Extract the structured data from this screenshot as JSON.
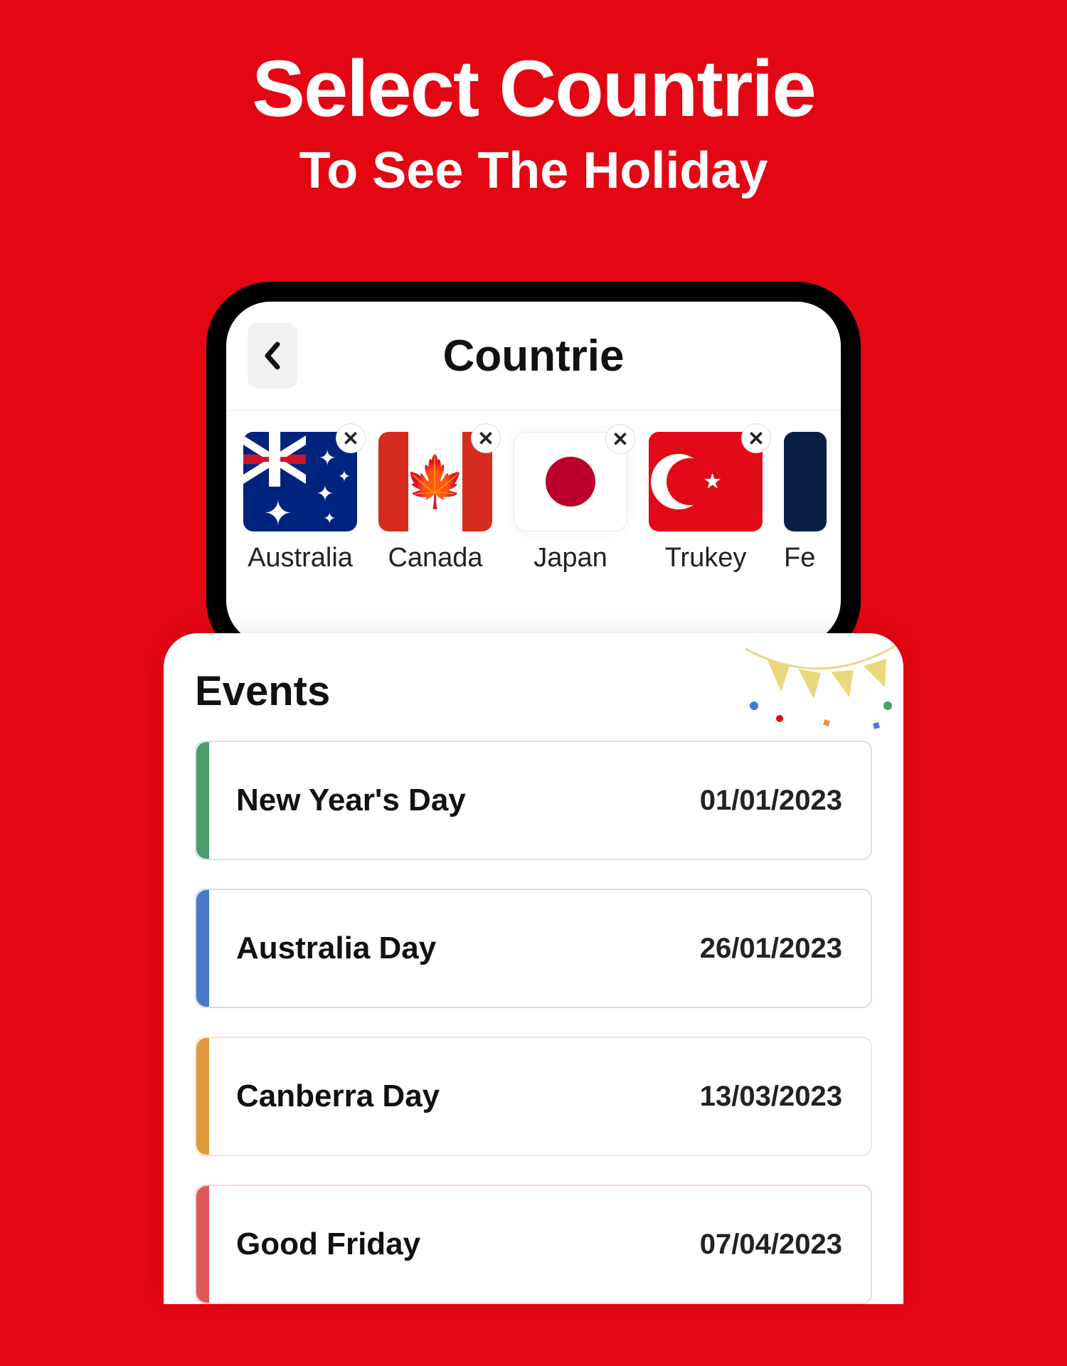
{
  "hero": {
    "title": "Select Countrie",
    "subtitle": "To See The Holiday"
  },
  "topbar": {
    "title": "Countrie"
  },
  "countries": [
    {
      "label": "Australia"
    },
    {
      "label": "Canada"
    },
    {
      "label": "Japan"
    },
    {
      "label": "Trukey"
    },
    {
      "label": "Fe"
    }
  ],
  "events": {
    "heading": "Events",
    "items": [
      {
        "name": "New Year's Day",
        "date": "01/01/2023",
        "color": "green"
      },
      {
        "name": "Australia Day",
        "date": "26/01/2023",
        "color": "blue"
      },
      {
        "name": "Canberra Day",
        "date": "13/03/2023",
        "color": "orange"
      },
      {
        "name": "Good Friday",
        "date": "07/04/2023",
        "color": "red"
      }
    ]
  }
}
